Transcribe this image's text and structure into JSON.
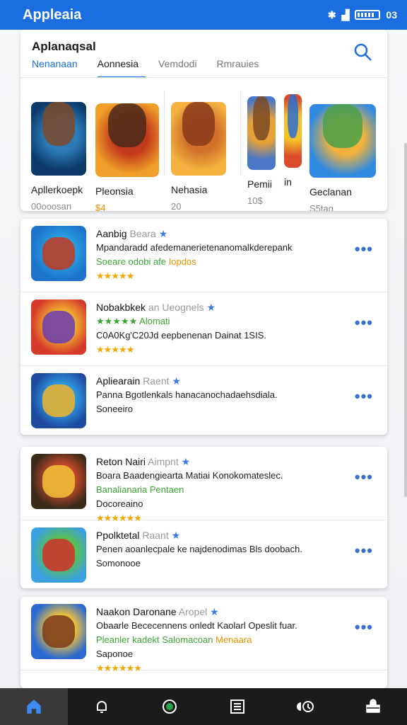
{
  "status": {
    "title": "Appleaia",
    "time": "03"
  },
  "search": {
    "title": "Aplanaqsal",
    "button": "search"
  },
  "tabs": [
    "Nenanaan",
    "Aonnesia",
    "Vemdodi",
    "Rmrauies"
  ],
  "featured": [
    {
      "name": "Apllerkoepk",
      "sub": "00ooosan",
      "icon": "cowboy-game-icon",
      "colors": [
        "#0b3a6a",
        "#2c7bb8",
        "#7a4a2a"
      ]
    },
    {
      "name": "Pleonsia",
      "sub": "$4",
      "icon": "hero-sword-icon",
      "colors": [
        "#f0a02a",
        "#c2391b",
        "#4a2a1a"
      ]
    },
    {
      "name": "Nehasia",
      "sub": "20",
      "icon": "bear-game-icon",
      "colors": [
        "#f4b340",
        "#d0702a",
        "#8a3a1a"
      ]
    },
    {
      "name": "Pemii",
      "sub": "10$",
      "icon": "warrior-game-icon",
      "colors": [
        "#4b78c6",
        "#e6a139",
        "#7a4a24"
      ]
    },
    {
      "name": "in",
      "sub": "",
      "icon": "blaze-game-icon",
      "colors": [
        "#d94b2a",
        "#f3c22a",
        "#2a6fd0"
      ]
    },
    {
      "name": "Geclanan",
      "sub": "S5tag",
      "icon": "monster-game-icon",
      "colors": [
        "#2f8ae0",
        "#f2b23c",
        "#4aa04a"
      ]
    }
  ],
  "list_groups": [
    [
      {
        "title": "Aanbig",
        "tag": "Beara",
        "desc": "Mpandaradd afedemanerietenanomalkderepank",
        "extra": "Soeare odobi afe",
        "extra2": "Iopdos",
        "meta": "",
        "rating": "★★★★★",
        "icon": "red-monster-icon",
        "colors": [
          "#1c73c9",
          "#2a9ee0",
          "#c13a1f"
        ]
      },
      {
        "title": "Nobakbkek",
        "tag": "an Ueognels",
        "desc": "",
        "extra": "★★★★★ Alomati",
        "extra2": "",
        "meta": "C0A0Kg'C20Jd eepbenenan Dainat 1SIS.",
        "rating": "★★★★★",
        "icon": "purple-hero-icon",
        "colors": [
          "#d63a2a",
          "#f0b030",
          "#6a3bb0"
        ]
      },
      {
        "title": "Apliearain",
        "tag": "Raent",
        "desc": "Panna Bgotlenkals hanacanochadaehsdiala.",
        "extra": "",
        "extra2": "",
        "meta": "Soneeiro",
        "rating": "",
        "icon": "saga-game-icon",
        "colors": [
          "#1e4aa0",
          "#2e9be0",
          "#f0b42a"
        ]
      }
    ],
    [
      {
        "title": "Reton Nairi",
        "tag": "Aimpnt",
        "desc": "Boara Baadengiearta Matiai Konokomateslec.",
        "extra": "Banalianaria Pentaen",
        "extra2": "",
        "meta": "Docoreaino",
        "rating": "★★★★★★",
        "icon": "game-battle-icon",
        "colors": [
          "#3a2a1a",
          "#c84a2a",
          "#f2c23a"
        ]
      },
      {
        "title": "Ppolktetal",
        "tag": "Raant",
        "desc": "Penen aoanlecpale ke najdenodimas Bls doobach.",
        "extra": "",
        "extra2": "",
        "meta": "Somonooe",
        "rating": "",
        "icon": "red-fighter-icon",
        "colors": [
          "#3aa0e0",
          "#5ac04a",
          "#d0302a"
        ]
      }
    ],
    [
      {
        "title": "Naakon Daronane",
        "tag": "Aropel",
        "desc": "Obaarle Bececennens onledt Kaolarl Opeslit fuar.",
        "extra": "Pleanler kadekt Salomacoan",
        "extra2": "Menaara",
        "meta": "Saponoe",
        "rating": "★★★★★★",
        "icon": "skies-game-icon",
        "colors": [
          "#2a6ad0",
          "#f2c23a",
          "#7a3a1a"
        ]
      }
    ]
  ],
  "navbar": [
    "home",
    "bell",
    "circle",
    "list",
    "camera",
    "bag"
  ]
}
